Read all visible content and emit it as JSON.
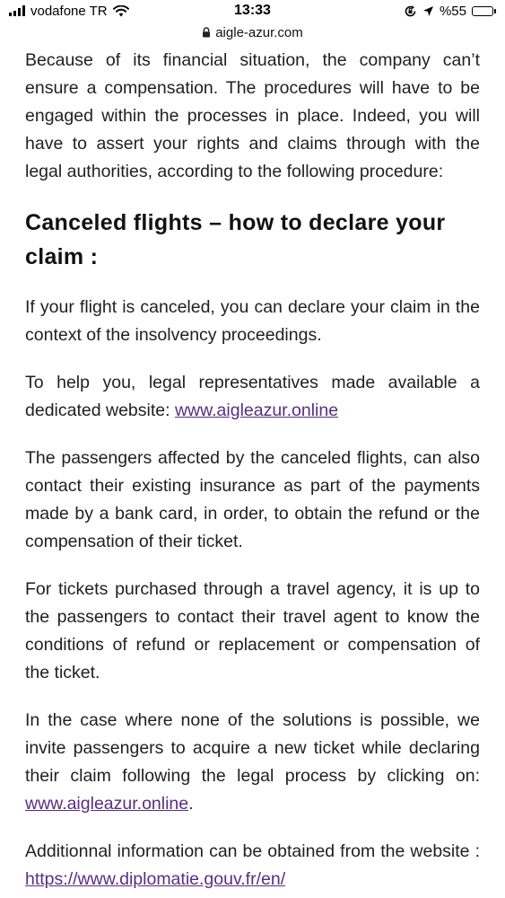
{
  "status_bar": {
    "carrier": "vodafone TR",
    "time": "13:33",
    "battery_percent": "%55",
    "battery_level": 0.55,
    "icons": [
      "signal-icon",
      "wifi-icon",
      "orientation-lock-icon",
      "location-arrow-icon",
      "battery-icon"
    ]
  },
  "url_bar": {
    "domain": "aigle-azur.com",
    "icon": "lock-icon"
  },
  "article": {
    "intro": "Because of its financial situation, the company can’t ensure a compensation. The procedures will have to be engaged within the processes in place. Indeed, you will have to assert your rights and claims through with the legal authorities, according to the following procedure:",
    "heading": "Canceled flights – how to declare your claim :",
    "p1": "If your flight is canceled, you can declare your claim in the context of the insolvency proceedings.",
    "p2_text": "To help you, legal representatives made available a dedicated website: ",
    "p2_link": "www.aigleazur.online",
    "p3": "The passengers affected by the canceled flights, can also contact their existing insurance as part of the payments made by a bank card, in order, to obtain the refund or the compensation of their ticket.",
    "p4": "For tickets purchased through a travel agency, it is up to the passengers to contact their travel agent to know the conditions of refund or replacement or compensation of the ticket.",
    "p5_text": "In the case where none of the solutions is possible, we invite passengers to acquire a new ticket while declaring their claim following the legal process by clicking on: ",
    "p5_link": "www.aigleazur.online",
    "p5_end": ".",
    "p6_text": "Additionnal information can be obtained from the website : ",
    "p6_link": "https://www.diplomatie.gouv.fr/en/"
  },
  "colors": {
    "link": "#5a2d82",
    "text": "#1f1f1f",
    "background": "#ffffff"
  }
}
